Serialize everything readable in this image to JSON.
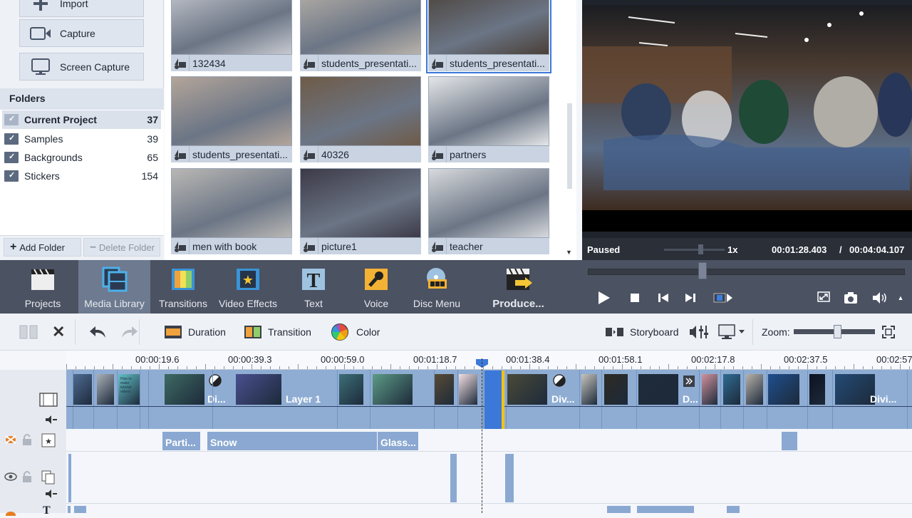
{
  "left_panel": {
    "import_label": "Import",
    "capture_label": "Capture",
    "screen_capture_label": "Screen Capture",
    "folders_header": "Folders",
    "folders": [
      {
        "name": "Current Project",
        "count": "37",
        "selected": true
      },
      {
        "name": "Samples",
        "count": "39"
      },
      {
        "name": "Backgrounds",
        "count": "65"
      },
      {
        "name": "Stickers",
        "count": "154"
      }
    ],
    "add_folder_label": "Add Folder",
    "delete_folder_label": "Delete Folder"
  },
  "media_grid": {
    "items": [
      {
        "name": "132434",
        "thumb_color": "#c7c9cf"
      },
      {
        "name": "students_presentati...",
        "thumb_color": "#b9b2a9"
      },
      {
        "name": "students_presentati...",
        "thumb_color": "#4a4038",
        "selected": true
      },
      {
        "name": "students_presentati...",
        "thumb_color": "#b3a59a"
      },
      {
        "name": "40326",
        "thumb_color": "#6f5b48"
      },
      {
        "name": "partners",
        "thumb_color": "#e4e6e8"
      },
      {
        "name": "men with book",
        "thumb_color": "#b9b7b4"
      },
      {
        "name": "picture1",
        "thumb_color": "#3d3a48"
      },
      {
        "name": "teacher",
        "thumb_color": "#d7d9dc"
      }
    ]
  },
  "preview": {
    "status": "Paused",
    "speed": "1x",
    "current_time": "00:01:28.403",
    "total_time": "00:04:04.107",
    "separator": "/",
    "seek_progress": 0.365,
    "speed_slider_value": 0.5
  },
  "main_toolbar": {
    "items": [
      {
        "label": "Projects"
      },
      {
        "label": "Media Library",
        "active": true
      },
      {
        "label": "Transitions"
      },
      {
        "label": "Video Effects"
      },
      {
        "label": "Text"
      },
      {
        "label": "Voice"
      },
      {
        "label": "Disc Menu"
      },
      {
        "label": "Produce..."
      }
    ]
  },
  "edit_toolbar": {
    "duration_label": "Duration",
    "transition_label": "Transition",
    "color_label": "Color",
    "storyboard_label": "Storyboard",
    "zoom_label": "Zoom:",
    "zoom_value": 0.55
  },
  "timeline": {
    "ruler_labels": [
      "00:00:19.6",
      "00:00:39.3",
      "00:00:59.0",
      "00:01:18.7",
      "00:01:38.4",
      "00:01:58.1",
      "00:02:17.8",
      "00:02:37.5",
      "00:02:57"
    ],
    "video_clip_labels": [
      "Di...",
      "Layer 1",
      "Div...",
      "D...",
      "Divi..."
    ],
    "effect_clips": [
      "Parti...",
      "Snow",
      "Glass..."
    ],
    "thumb_text": "How to make tutorial videos"
  }
}
